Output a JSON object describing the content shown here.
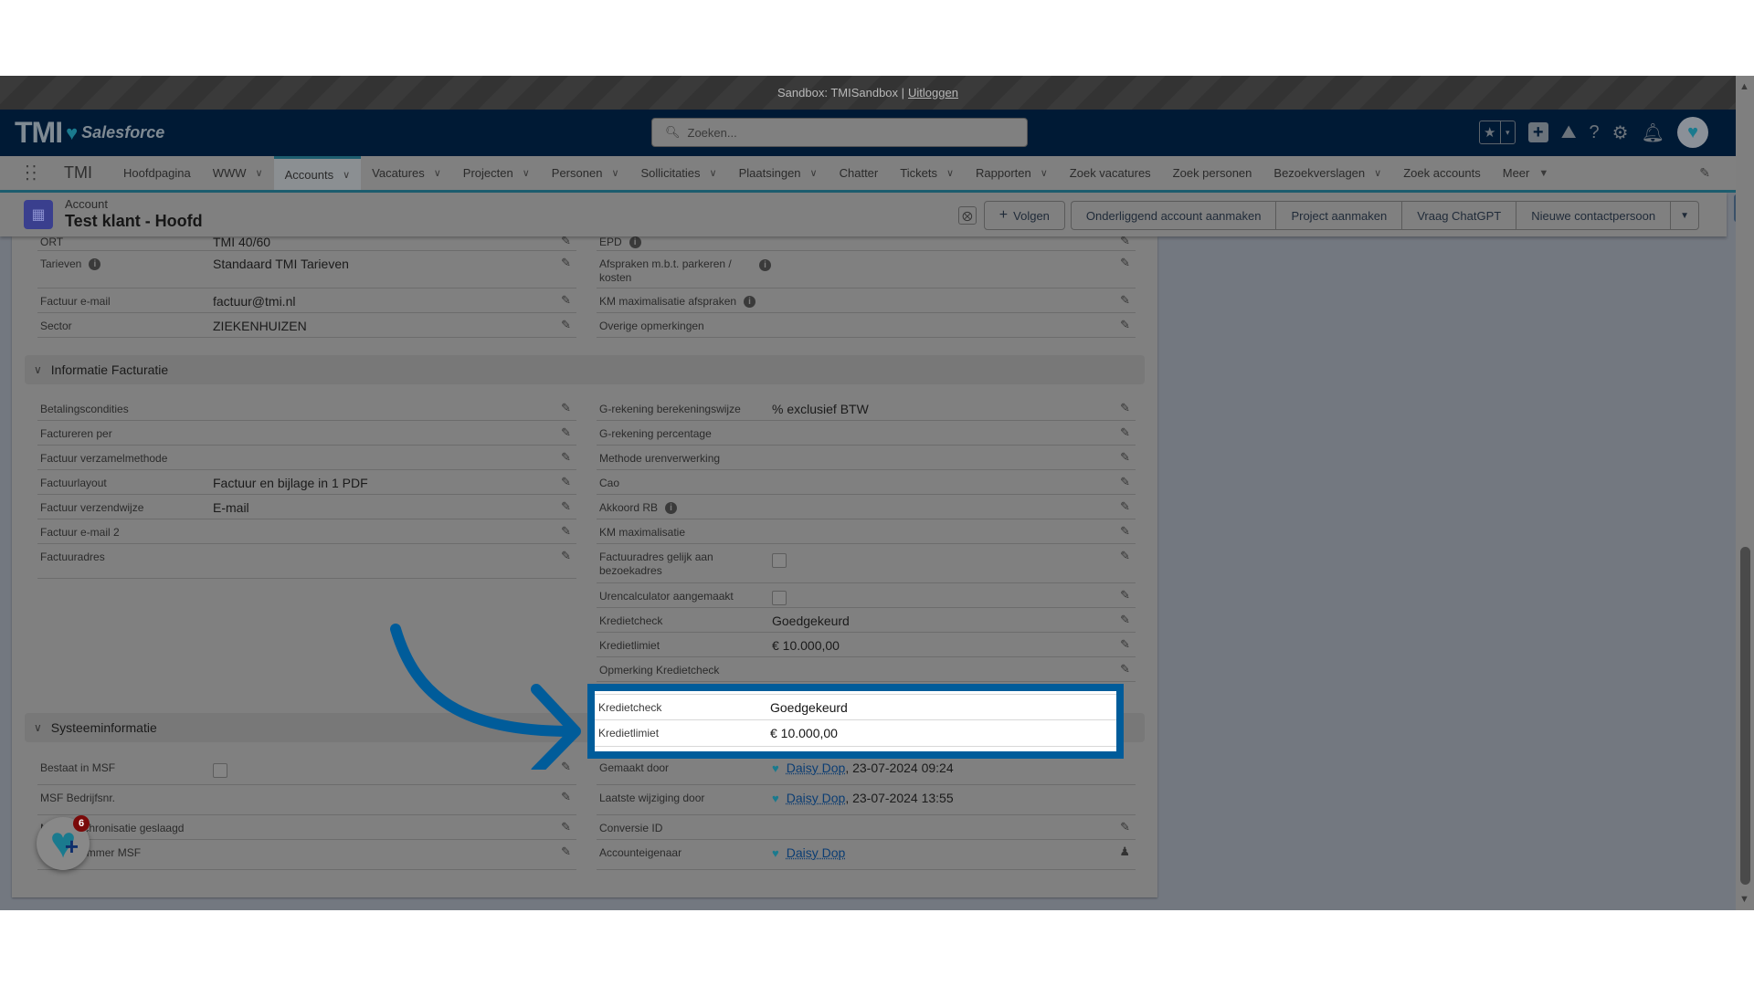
{
  "sandbox_bar": {
    "text": "Sandbox: TMISandbox |",
    "logout_link": "Uitloggen"
  },
  "header": {
    "logo_text": "TMI",
    "logo_sub": "Salesforce",
    "search_placeholder": "Zoeken...",
    "icons": [
      "favorites-star-icon",
      "favorites-dropdown-icon",
      "global-create-icon",
      "trailhead-icon",
      "help-icon",
      "setup-gear-icon",
      "notifications-bell-icon",
      "user-avatar"
    ]
  },
  "nav": {
    "app_name": "TMI",
    "items": [
      {
        "label": "Hoofdpagina",
        "has_dropdown": false,
        "active": false
      },
      {
        "label": "WWW",
        "has_dropdown": true,
        "active": false
      },
      {
        "label": "Accounts",
        "has_dropdown": true,
        "active": true
      },
      {
        "label": "Vacatures",
        "has_dropdown": true,
        "active": false
      },
      {
        "label": "Projecten",
        "has_dropdown": true,
        "active": false
      },
      {
        "label": "Personen",
        "has_dropdown": true,
        "active": false
      },
      {
        "label": "Sollicitaties",
        "has_dropdown": true,
        "active": false
      },
      {
        "label": "Plaatsingen",
        "has_dropdown": true,
        "active": false
      },
      {
        "label": "Chatter",
        "has_dropdown": false,
        "active": false
      },
      {
        "label": "Tickets",
        "has_dropdown": true,
        "active": false
      },
      {
        "label": "Rapporten",
        "has_dropdown": true,
        "active": false
      },
      {
        "label": "Zoek vacatures",
        "has_dropdown": false,
        "active": false
      },
      {
        "label": "Zoek personen",
        "has_dropdown": false,
        "active": false
      },
      {
        "label": "Bezoekverslagen",
        "has_dropdown": true,
        "active": false
      },
      {
        "label": "Zoek accounts",
        "has_dropdown": false,
        "active": false
      },
      {
        "label": "Meer",
        "has_dropdown": true,
        "active": false
      }
    ]
  },
  "record": {
    "type": "Account",
    "title": "Test klant - Hoofd",
    "follow_label": "Volgen",
    "actions": [
      "Onderliggend account aanmaken",
      "Project aanmaken",
      "Vraag ChatGPT",
      "Nieuwe contactpersoon"
    ]
  },
  "top_fields": {
    "left": [
      {
        "label": "ORT",
        "value": "TMI 40/60"
      },
      {
        "label": "Tarieven",
        "value": "Standaard TMI Tarieven",
        "info": true
      },
      {
        "label": "Factuur e-mail",
        "value": "factuur@tmi.nl",
        "link": true
      },
      {
        "label": "Sector",
        "value": "ZIEKENHUIZEN"
      }
    ],
    "right": [
      {
        "label": "EPD",
        "value": "",
        "info": true
      },
      {
        "label": "Afspraken m.b.t. parkeren / kosten",
        "value": "",
        "info": true
      },
      {
        "label": "KM maximalisatie afspraken",
        "value": "",
        "info": true
      },
      {
        "label": "Overige opmerkingen",
        "value": ""
      }
    ]
  },
  "section_facturatie": {
    "title": "Informatie Facturatie",
    "left": [
      {
        "label": "Betalingscondities",
        "value": ""
      },
      {
        "label": "Factureren per",
        "value": ""
      },
      {
        "label": "Factuur verzamelmethode",
        "value": ""
      },
      {
        "label": "Factuurlayout",
        "value": "Factuur en bijlage in 1 PDF"
      },
      {
        "label": "Factuur verzendwijze",
        "value": "E-mail"
      },
      {
        "label": "Factuur e-mail 2",
        "value": ""
      },
      {
        "label": "Factuuradres",
        "value": ""
      }
    ],
    "right": [
      {
        "label": "G-rekening berekeningswijze",
        "value": "% exclusief BTW"
      },
      {
        "label": "G-rekening percentage",
        "value": ""
      },
      {
        "label": "Methode urenverwerking",
        "value": ""
      },
      {
        "label": "Cao",
        "value": ""
      },
      {
        "label": "Akkoord RB",
        "value": "",
        "info": true
      },
      {
        "label": "KM maximalisatie",
        "value": ""
      },
      {
        "label": "Factuuradres gelijk aan bezoekadres",
        "checkbox": true,
        "checked": false
      },
      {
        "label": "Urencalculator aangemaakt",
        "checkbox": true,
        "checked": false
      },
      {
        "label": "Kredietcheck",
        "value": "Goedgekeurd"
      },
      {
        "label": "Kredietlimiet",
        "value": "€ 10.000,00"
      },
      {
        "label": "Opmerking Kredietcheck",
        "value": ""
      }
    ]
  },
  "highlight": {
    "rows": [
      {
        "label": "Kredietcheck",
        "value": "Goedgekeurd"
      },
      {
        "label": "Kredietlimiet",
        "value": "€ 10.000,00"
      }
    ],
    "color": "#005c9a"
  },
  "section_systeem": {
    "title": "Systeeminformatie",
    "left": [
      {
        "label": "Bestaat in MSF",
        "checkbox": true,
        "checked": false
      },
      {
        "label": "MSF Bedrijfsnr.",
        "value": ""
      },
      {
        "label": "MSF synchronisatie geslaagd",
        "value": ""
      },
      {
        "label": "Relatienummer MSF",
        "value": ""
      }
    ],
    "right": [
      {
        "label": "Gemaakt door",
        "user": "Daisy Dop",
        "suffix": ", 23-07-2024 09:24"
      },
      {
        "label": "Laatste wijziging door",
        "user": "Daisy Dop",
        "suffix": ", 23-07-2024 13:55"
      },
      {
        "label": "Conversie ID",
        "value": ""
      },
      {
        "label": "Accounteigenaar",
        "user": "Daisy Dop",
        "suffix": ""
      }
    ]
  },
  "fab": {
    "badge_count": "6"
  }
}
